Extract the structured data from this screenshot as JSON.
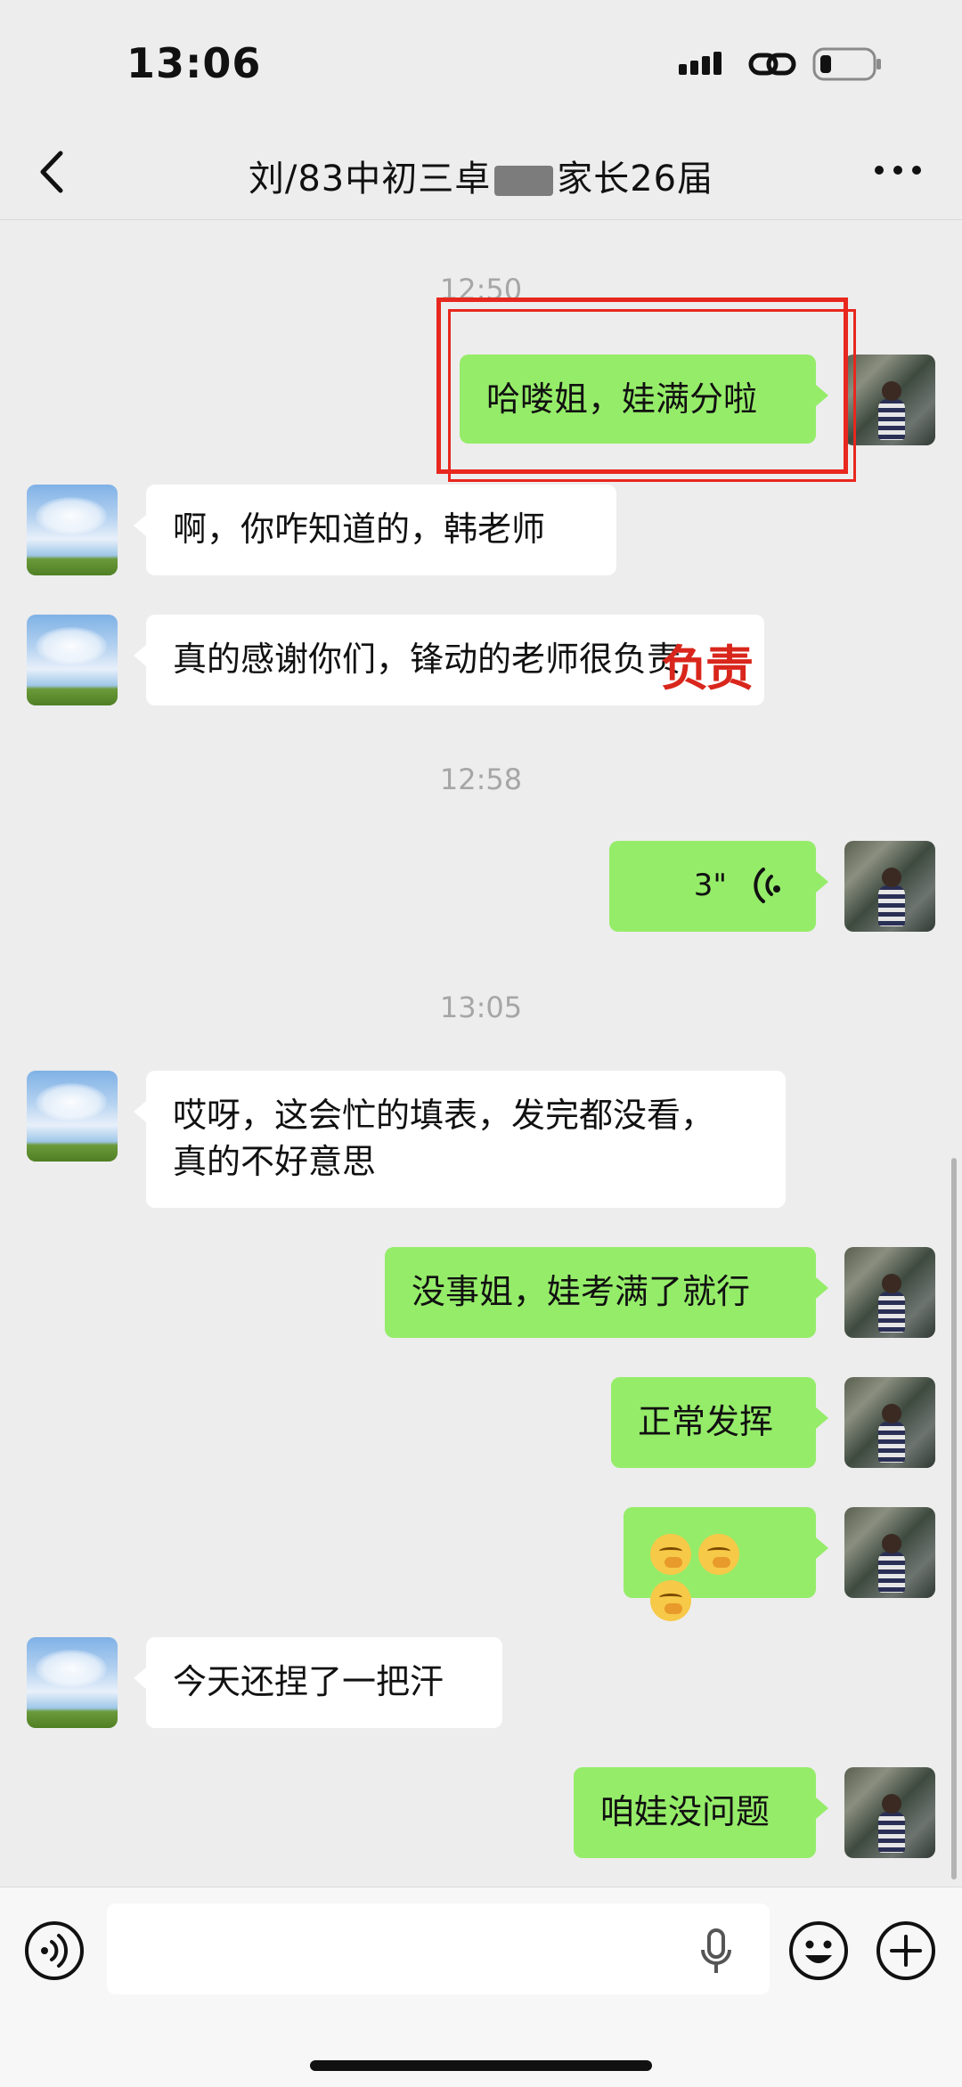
{
  "status_bar": {
    "time": "13:06"
  },
  "header": {
    "title_left": "刘/83中初三",
    "title_partial": "卓",
    "title_right": "家长26届"
  },
  "messages": {
    "t1": "12:50",
    "m1": "哈喽姐，娃满分啦",
    "m2": "啊，你咋知道的，韩老师",
    "m3": "真的感谢你们，锋动的老师很负责",
    "t2": "12:58",
    "m4_duration": "3\"",
    "t3": "13:05",
    "m5_line1": "哎呀，这会忙的填表，发完都没看，",
    "m5_line2": "真的不好意思",
    "m6": "没事姐，娃考满了就行",
    "m7": "正常发挥",
    "m9": "今天还捏了一把汗",
    "m10": "咱娃没问题"
  },
  "overlay": {
    "word": "负责",
    "color": "#d9261c"
  },
  "colors": {
    "out_bubble": "#95ec69",
    "in_bubble": "#ffffff",
    "background": "#ededed",
    "highlight": "#e8271e"
  },
  "icons": [
    "back-icon",
    "more-icon",
    "voice-message-icon",
    "voice-toggle-icon",
    "mic-icon",
    "emoji-icon",
    "plus-icon"
  ]
}
